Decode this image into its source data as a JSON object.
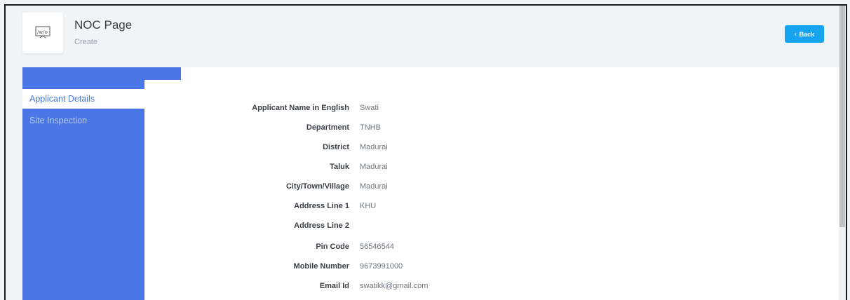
{
  "header": {
    "title": "NOC Page",
    "subtitle": "Create",
    "icon": "noc-form-icon",
    "back_label": "Back"
  },
  "sidebar": {
    "tabs": [
      {
        "label": "Applicant Details",
        "active": true
      },
      {
        "label": "Site Inspection",
        "active": false
      }
    ]
  },
  "details": [
    {
      "label": "Applicant Name in English",
      "value": "Swati"
    },
    {
      "label": "Department",
      "value": "TNHB"
    },
    {
      "label": "District",
      "value": "Madurai"
    },
    {
      "label": "Taluk",
      "value": "Madurai"
    },
    {
      "label": "City/Town/Village",
      "value": "Madurai"
    },
    {
      "label": "Address Line 1",
      "value": "KHU"
    },
    {
      "label": "Address Line 2",
      "value": ""
    },
    {
      "label": "Pin Code",
      "value": "56546544"
    },
    {
      "label": "Mobile Number",
      "value": "9673991000"
    },
    {
      "label": "Email Id",
      "value": "swatikk@gmail.com"
    }
  ],
  "colors": {
    "sidebar": "#4a77e5",
    "back_button": "#16a4f0",
    "active_tab_text": "#4a77e5"
  }
}
